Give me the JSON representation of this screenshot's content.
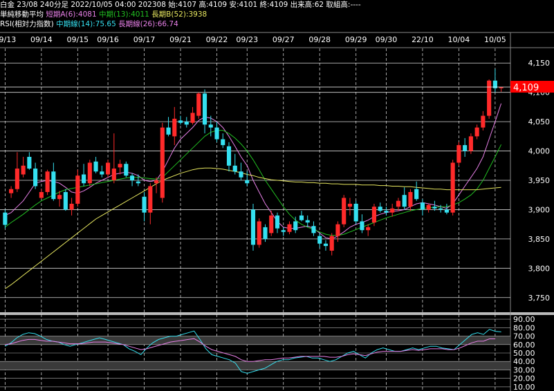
{
  "header": {
    "line1": {
      "product": "白金 23/08 240分足",
      "datetime": "2022/10/05 04:00",
      "code": "202308",
      "open_label": "始:4107",
      "high_label": "高:4109",
      "low_label": "安:4101",
      "close_label": "終:4109",
      "volume_label": "出来高:62",
      "oi_label": "取組高:----"
    },
    "line2": {
      "title": "単純移動平均",
      "short_label": "短期A(6):4081",
      "mid_label": "中期(13):4011",
      "long_label": "長期B(52):3938"
    },
    "line3": {
      "title": "RSI(相対力指数)",
      "mid_label": "中期線(14):75.65",
      "long_label": "長期線(26):66.74"
    }
  },
  "colors": {
    "background": "#000000",
    "up": "#ff2a2a",
    "down": "#35e0f0",
    "ma_short": "#e880e8",
    "ma_mid": "#22c022",
    "ma_long": "#e8e860",
    "rsi_mid": "#35e0f0",
    "rsi_long": "#e880e8",
    "price_tag": "#ff0000",
    "grid": "#ffffff"
  },
  "chart_data": [
    {
      "type": "candlestick",
      "title": "",
      "x_labels": [
        "09/13",
        "09/14",
        "09/15",
        "09/16",
        "09/17",
        "09/21",
        "09/22",
        "09/23",
        "09/27",
        "09/28",
        "09/29",
        "09/30",
        "22/10",
        "10/04",
        "10/05"
      ],
      "ylim": [
        3725,
        4175
      ],
      "y_ticks": [
        3750,
        3800,
        3850,
        3900,
        3950,
        4000,
        4050,
        4100,
        4150
      ],
      "y_tick_labels": [
        "3,750",
        "3,800",
        "3,850",
        "3,900",
        "3,950",
        "4,000",
        "4,050",
        "4,100",
        "4,150"
      ],
      "last_price": 4109,
      "last_price_label": "4,109",
      "candles": [
        [
          3895,
          3900,
          3868,
          3874
        ],
        [
          3928,
          3940,
          3920,
          3935
        ],
        [
          3935,
          3998,
          3930,
          3970
        ],
        [
          3960,
          3990,
          3955,
          3975
        ],
        [
          3990,
          3998,
          3968,
          3970
        ],
        [
          3970,
          3980,
          3935,
          3940
        ],
        [
          3920,
          3935,
          3918,
          3930
        ],
        [
          3930,
          3968,
          3925,
          3965
        ],
        [
          3965,
          3980,
          3915,
          3918
        ],
        [
          3918,
          3932,
          3905,
          3925
        ],
        [
          3930,
          3935,
          3898,
          3900
        ],
        [
          3900,
          3920,
          3890,
          3910
        ],
        [
          3910,
          3968,
          3905,
          3958
        ],
        [
          3960,
          3978,
          3940,
          3945
        ],
        [
          3945,
          3985,
          3940,
          3980
        ],
        [
          3982,
          3990,
          3962,
          3965
        ],
        [
          3965,
          3975,
          3955,
          3960
        ],
        [
          3960,
          3985,
          3955,
          3980
        ],
        [
          3950,
          4030,
          3945,
          3970
        ],
        [
          3972,
          3985,
          3960,
          3978
        ],
        [
          3978,
          3982,
          3955,
          3958
        ],
        [
          3958,
          3962,
          3940,
          3950
        ],
        [
          3948,
          3960,
          3940,
          3945
        ],
        [
          3922,
          3930,
          3880,
          3895
        ],
        [
          3895,
          3945,
          3875,
          3940
        ],
        [
          3945,
          3955,
          3928,
          3950
        ],
        [
          3920,
          4048,
          3912,
          4040
        ],
        [
          4040,
          4058,
          4025,
          4028
        ],
        [
          4025,
          4075,
          4010,
          4055
        ],
        [
          4052,
          4060,
          4045,
          4048
        ],
        [
          4050,
          4058,
          4040,
          4045
        ],
        [
          4048,
          4075,
          4045,
          4065
        ],
        [
          4060,
          4100,
          4055,
          4098
        ],
        [
          4098,
          4105,
          4030,
          4045
        ],
        [
          4045,
          4060,
          4025,
          4040
        ],
        [
          4040,
          4050,
          4015,
          4020
        ],
        [
          4020,
          4030,
          4005,
          4010
        ],
        [
          4008,
          4015,
          3965,
          3975
        ],
        [
          3975,
          3995,
          3960,
          3965
        ],
        [
          3965,
          3980,
          3950,
          3955
        ],
        [
          3950,
          3965,
          3940,
          3945
        ],
        [
          3900,
          3910,
          3830,
          3840
        ],
        [
          3840,
          3885,
          3835,
          3880
        ],
        [
          3870,
          3875,
          3845,
          3850
        ],
        [
          3860,
          3898,
          3855,
          3890
        ],
        [
          3890,
          3895,
          3860,
          3868
        ],
        [
          3865,
          3870,
          3855,
          3862
        ],
        [
          3862,
          3880,
          3858,
          3875
        ],
        [
          3880,
          3888,
          3860,
          3865
        ],
        [
          3890,
          3898,
          3880,
          3882
        ],
        [
          3882,
          3890,
          3870,
          3878
        ],
        [
          3872,
          3880,
          3855,
          3860
        ],
        [
          3855,
          3860,
          3835,
          3842
        ],
        [
          3842,
          3848,
          3830,
          3838
        ],
        [
          3830,
          3860,
          3822,
          3855
        ],
        [
          3855,
          3880,
          3845,
          3875
        ],
        [
          3875,
          3925,
          3870,
          3920
        ],
        [
          3905,
          3920,
          3890,
          3910
        ],
        [
          3910,
          3915,
          3875,
          3880
        ],
        [
          3880,
          3892,
          3860,
          3865
        ],
        [
          3865,
          3875,
          3855,
          3870
        ],
        [
          3878,
          3910,
          3872,
          3905
        ],
        [
          3905,
          3912,
          3895,
          3898
        ],
        [
          3898,
          3905,
          3890,
          3895
        ],
        [
          3895,
          3910,
          3888,
          3902
        ],
        [
          3905,
          3920,
          3898,
          3915
        ],
        [
          3925,
          3938,
          3900,
          3905
        ],
        [
          3905,
          3935,
          3898,
          3930
        ],
        [
          3935,
          3948,
          3915,
          3918
        ],
        [
          3912,
          3918,
          3890,
          3900
        ],
        [
          3900,
          3910,
          3895,
          3908
        ],
        [
          3905,
          3915,
          3898,
          3902
        ],
        [
          3902,
          3908,
          3895,
          3900
        ],
        [
          3900,
          3910,
          3892,
          3895
        ],
        [
          3895,
          3985,
          3890,
          3980
        ],
        [
          3980,
          4015,
          3975,
          4010
        ],
        [
          4010,
          4022,
          3990,
          4000
        ],
        [
          4000,
          4030,
          3995,
          4025
        ],
        [
          4025,
          4045,
          4020,
          4040
        ],
        [
          4040,
          4068,
          4035,
          4060
        ],
        [
          4060,
          4122,
          4055,
          4120
        ],
        [
          4120,
          4140,
          4100,
          4107
        ],
        [
          4107,
          4109,
          4101,
          4109
        ]
      ],
      "series": [
        {
          "name": "短期A(6)",
          "color": "#e880e8",
          "values": [
            3890,
            3895,
            3905,
            3915,
            3930,
            3945,
            3948,
            3950,
            3948,
            3945,
            3938,
            3930,
            3928,
            3932,
            3938,
            3945,
            3950,
            3955,
            3960,
            3962,
            3964,
            3962,
            3958,
            3950,
            3948,
            3950,
            3965,
            3985,
            4005,
            4020,
            4030,
            4040,
            4052,
            4058,
            4056,
            4050,
            4040,
            4025,
            4008,
            3990,
            3975,
            3950,
            3930,
            3910,
            3895,
            3880,
            3870,
            3868,
            3868,
            3870,
            3872,
            3868,
            3860,
            3852,
            3850,
            3855,
            3862,
            3870,
            3875,
            3878,
            3882,
            3888,
            3892,
            3895,
            3897,
            3898,
            3900,
            3905,
            3910,
            3912,
            3910,
            3908,
            3905,
            3902,
            3910,
            3925,
            3940,
            3955,
            3970,
            3990,
            4020,
            4050,
            4081
          ]
        },
        {
          "name": "中期(13)",
          "color": "#22c022",
          "values": [
            3870,
            3878,
            3885,
            3892,
            3900,
            3908,
            3915,
            3920,
            3925,
            3930,
            3934,
            3936,
            3938,
            3940,
            3942,
            3944,
            3946,
            3948,
            3950,
            3952,
            3954,
            3955,
            3955,
            3954,
            3953,
            3952,
            3955,
            3965,
            3975,
            3985,
            3995,
            4005,
            4015,
            4025,
            4032,
            4035,
            4035,
            4030,
            4022,
            4012,
            4000,
            3985,
            3968,
            3950,
            3935,
            3920,
            3905,
            3892,
            3882,
            3875,
            3870,
            3866,
            3862,
            3858,
            3856,
            3856,
            3858,
            3862,
            3866,
            3870,
            3874,
            3878,
            3882,
            3886,
            3889,
            3892,
            3895,
            3898,
            3900,
            3902,
            3903,
            3904,
            3905,
            3905,
            3908,
            3912,
            3918,
            3925,
            3935,
            3950,
            3970,
            3990,
            4011
          ]
        },
        {
          "name": "長期B(52)",
          "color": "#e8e860",
          "values": [
            3765,
            3772,
            3780,
            3788,
            3796,
            3804,
            3812,
            3820,
            3828,
            3836,
            3844,
            3852,
            3860,
            3868,
            3876,
            3884,
            3890,
            3896,
            3902,
            3908,
            3914,
            3920,
            3926,
            3932,
            3938,
            3944,
            3950,
            3954,
            3958,
            3962,
            3965,
            3968,
            3970,
            3971,
            3971,
            3970,
            3969,
            3967,
            3965,
            3963,
            3960,
            3958,
            3955,
            3953,
            3951,
            3950,
            3949,
            3948,
            3947,
            3947,
            3946,
            3946,
            3945,
            3945,
            3944,
            3944,
            3943,
            3943,
            3943,
            3942,
            3942,
            3942,
            3941,
            3941,
            3940,
            3940,
            3939,
            3939,
            3938,
            3937,
            3936,
            3935,
            3935,
            3934,
            3934,
            3934,
            3934,
            3934,
            3934,
            3935,
            3936,
            3937,
            3938
          ]
        }
      ]
    },
    {
      "type": "line",
      "title": "",
      "ylim": [
        5,
        95
      ],
      "y_ticks": [
        10,
        20,
        30,
        40,
        50,
        60,
        70,
        80,
        90
      ],
      "y_tick_labels": [
        "10.00",
        "20.00",
        "30.00",
        "40.00",
        "50.00",
        "60.00",
        "70.00",
        "80.00",
        "90.00"
      ],
      "bands": [
        [
          30,
          40
        ],
        [
          60,
          70
        ]
      ],
      "series": [
        {
          "name": "中期線(14)",
          "color": "#35e0f0",
          "values": [
            58,
            62,
            68,
            72,
            74,
            73,
            70,
            66,
            64,
            63,
            60,
            58,
            60,
            62,
            64,
            66,
            68,
            66,
            64,
            62,
            60,
            55,
            52,
            48,
            56,
            62,
            66,
            68,
            70,
            70,
            72,
            74,
            76,
            66,
            55,
            48,
            46,
            44,
            42,
            38,
            28,
            26,
            28,
            30,
            32,
            36,
            40,
            42,
            42,
            44,
            45,
            46,
            44,
            44,
            42,
            40,
            42,
            46,
            50,
            52,
            48,
            44,
            50,
            54,
            56,
            54,
            52,
            52,
            54,
            56,
            54,
            56,
            58,
            58,
            56,
            55,
            54,
            60,
            66,
            72,
            74,
            72,
            78,
            75.65,
            75
          ]
        },
        {
          "name": "長期線(26)",
          "color": "#e880e8",
          "values": [
            60,
            61,
            63,
            65,
            66,
            66,
            65,
            64,
            64,
            63,
            62,
            61,
            61,
            61,
            62,
            63,
            63,
            63,
            62,
            61,
            60,
            58,
            56,
            54,
            55,
            57,
            59,
            61,
            63,
            64,
            65,
            66,
            67,
            63,
            58,
            54,
            52,
            50,
            48,
            46,
            42,
            40,
            40,
            41,
            42,
            42,
            43,
            44,
            44,
            45,
            46,
            46,
            46,
            46,
            46,
            45,
            45,
            46,
            48,
            49,
            48,
            47,
            49,
            51,
            52,
            52,
            52,
            52,
            53,
            54,
            53,
            54,
            55,
            55,
            55,
            54,
            54,
            56,
            59,
            62,
            64,
            64,
            66.74,
            66.74
          ]
        }
      ]
    }
  ]
}
